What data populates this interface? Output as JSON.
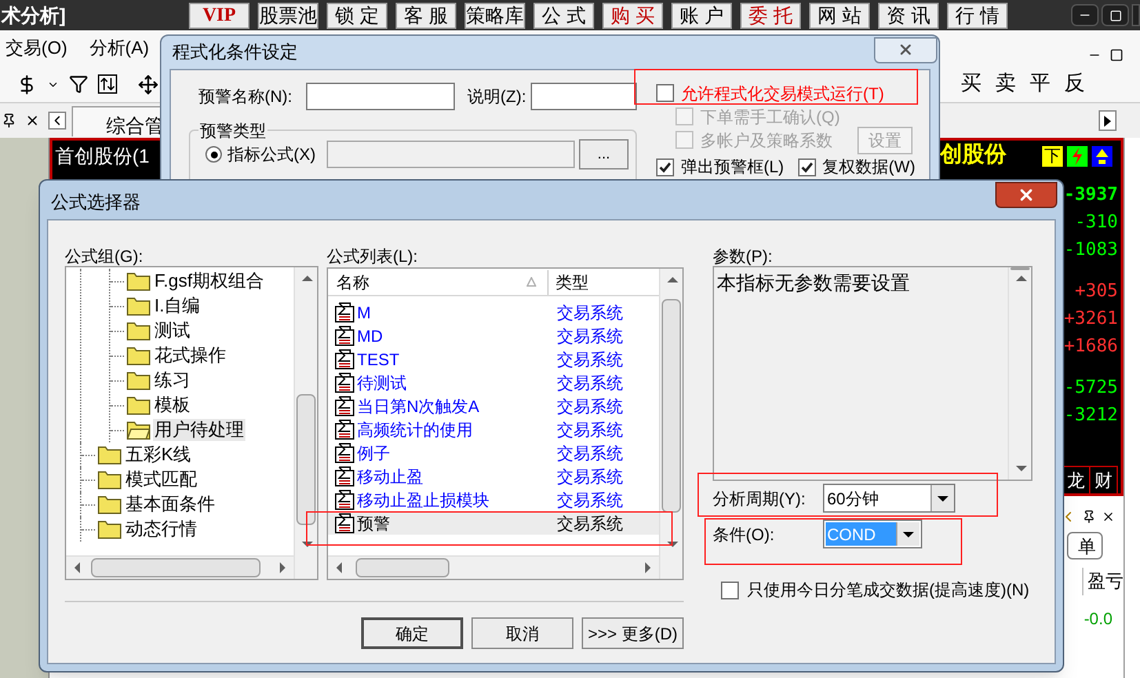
{
  "window": {
    "title": "术分析]"
  },
  "top_buttons": [
    {
      "label": "VIP",
      "color": "#c00000"
    },
    {
      "label": "股票池",
      "color": "#000000"
    },
    {
      "label": "锁 定",
      "color": "#000000"
    },
    {
      "label": "客 服",
      "color": "#000000"
    },
    {
      "label": "策略库",
      "color": "#000000"
    },
    {
      "label": "公 式",
      "color": "#000000"
    },
    {
      "label": "购 买",
      "color": "#c00000"
    },
    {
      "label": "账 户",
      "color": "#000000"
    },
    {
      "label": "委 托",
      "color": "#c00000"
    },
    {
      "label": "网 站",
      "color": "#000000"
    },
    {
      "label": "资 讯",
      "color": "#000000"
    },
    {
      "label": "行 情",
      "color": "#000000"
    }
  ],
  "menu": [
    "交易(O)",
    "分析(A)"
  ],
  "trade_buttons": [
    "买",
    "卖",
    "平",
    "反"
  ],
  "tab": {
    "label": "综合管"
  },
  "quote": {
    "title": "首创股份(1",
    "name": "创股份",
    "badge": "下",
    "values": [
      {
        "text": "-3937",
        "color": "#00ff00"
      },
      {
        "text": "-310",
        "color": "#00ff00"
      },
      {
        "text": "-1083",
        "color": "#00ff00"
      },
      {
        "text": "+305",
        "color": "#ff3030"
      },
      {
        "text": "+3261",
        "color": "#ff3030"
      },
      {
        "text": "+1686",
        "color": "#ff3030"
      },
      {
        "text": "-5725",
        "color": "#00ff00"
      },
      {
        "text": "-3212",
        "color": "#00ff00"
      }
    ],
    "tabs": [
      "龙",
      "财"
    ]
  },
  "lower_panel": {
    "button": "单",
    "column": "盈亏",
    "value": "-0.0"
  },
  "condition_dialog": {
    "title": "程式化条件设定",
    "name_label": "预警名称(N):",
    "desc_label": "说明(Z):",
    "type_group": "预警类型",
    "radio": {
      "label": "指标公式(X)",
      "selected": true
    },
    "browse_button": "...",
    "options": [
      {
        "label": "允许程式化交易模式运行(T)",
        "checked": false,
        "disabled": false,
        "color": "#ff0000"
      },
      {
        "label": "下单需手工确认(Q)",
        "checked": false,
        "disabled": true
      },
      {
        "label": "多帐户及策略系数",
        "checked": false,
        "disabled": true
      }
    ],
    "settings_button": {
      "label": "设置",
      "disabled": true
    },
    "bottom_options": [
      {
        "label": "弹出预警框(L)",
        "checked": true
      },
      {
        "label": "复权数据(W)",
        "checked": true
      }
    ]
  },
  "formula_dialog": {
    "title": "公式选择器",
    "group_label": "公式组(G):",
    "tree": [
      {
        "children": [
          {
            "label": "F.gsf期权组合",
            "selected": false
          },
          {
            "label": "I.自编",
            "selected": false
          },
          {
            "label": "测试",
            "selected": false
          },
          {
            "label": "花式操作",
            "selected": false
          },
          {
            "label": "练习",
            "selected": false
          },
          {
            "label": "模板",
            "selected": false
          },
          {
            "label": "用户待处理",
            "selected": true
          }
        ]
      },
      {
        "label": "五彩K线",
        "selected": false
      },
      {
        "label": "模式匹配",
        "selected": false
      },
      {
        "label": "基本面条件",
        "selected": false
      },
      {
        "label": "动态行情",
        "selected": false
      }
    ],
    "list_label": "公式列表(L):",
    "columns": [
      "名称",
      "类型"
    ],
    "rows": [
      {
        "name": "M",
        "type": "交易系统",
        "selected": false
      },
      {
        "name": "MD",
        "type": "交易系统",
        "selected": false
      },
      {
        "name": "TEST",
        "type": "交易系统",
        "selected": false
      },
      {
        "name": "待测试",
        "type": "交易系统",
        "selected": false
      },
      {
        "name": "当日第N次触发A",
        "type": "交易系统",
        "selected": false
      },
      {
        "name": "高频统计的使用",
        "type": "交易系统",
        "selected": false
      },
      {
        "name": "例子",
        "type": "交易系统",
        "selected": false
      },
      {
        "name": "移动止盈",
        "type": "交易系统",
        "selected": false
      },
      {
        "name": "移动止盈止损模块",
        "type": "交易系统",
        "selected": false
      },
      {
        "name": "预警",
        "type": "交易系统",
        "selected": true
      }
    ],
    "params_label": "参数(P):",
    "params_text": "本指标无参数需要设置",
    "period": {
      "label": "分析周期(Y):",
      "value": "60分钟"
    },
    "condition": {
      "label": "条件(O):",
      "value": "COND",
      "selected": true
    },
    "tick_option": {
      "label": "只使用今日分笔成交数据(提高速度)(N)",
      "checked": false
    },
    "buttons": [
      "确定",
      "取消",
      ">>> 更多(D)"
    ]
  }
}
